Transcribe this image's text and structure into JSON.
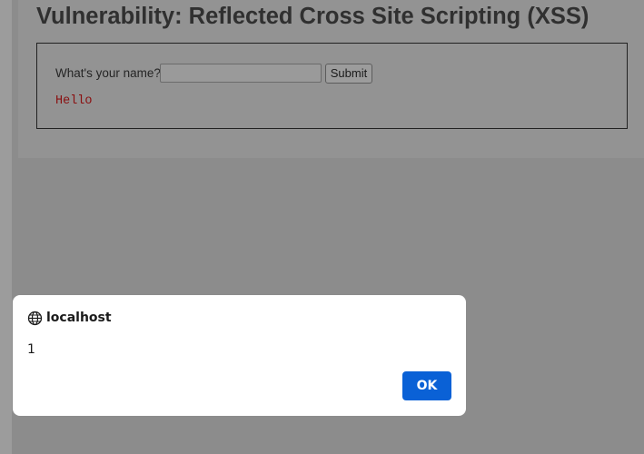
{
  "page": {
    "title": "Vulnerability: Reflected Cross Site Scripting (XSS)",
    "form": {
      "name_label": "What's your name?",
      "name_input_value": "",
      "submit_label": "Submit"
    },
    "output_text": "Hello"
  },
  "alert": {
    "origin": "localhost",
    "origin_icon": "globe-icon",
    "message": "1",
    "ok_label": "OK"
  },
  "colors": {
    "overlay_background": "#8c8c8c",
    "output_text": "#8a0f10",
    "ok_button": "#0a61d6"
  }
}
